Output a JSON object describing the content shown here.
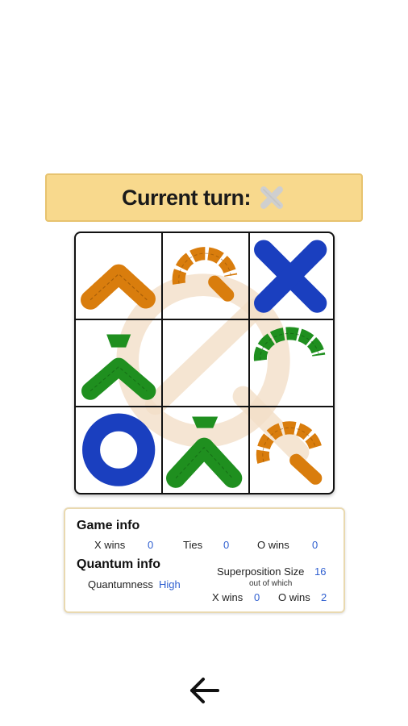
{
  "turn": {
    "label": "Current turn:",
    "current_player_icon": "x-mark-icon",
    "icon_color": "#cfcfcf"
  },
  "board": {
    "cells": [
      {
        "row": 0,
        "col": 0,
        "piece": "quantum-x-fragment",
        "color": "orange"
      },
      {
        "row": 0,
        "col": 1,
        "piece": "quantum-o-fragment",
        "color": "orange"
      },
      {
        "row": 0,
        "col": 2,
        "piece": "classical-x",
        "color": "blue"
      },
      {
        "row": 1,
        "col": 0,
        "piece": "quantum-x-fragment",
        "color": "green"
      },
      {
        "row": 1,
        "col": 1,
        "piece": "empty",
        "color": ""
      },
      {
        "row": 1,
        "col": 2,
        "piece": "quantum-o-fragment",
        "color": "green"
      },
      {
        "row": 2,
        "col": 0,
        "piece": "classical-o",
        "color": "blue"
      },
      {
        "row": 2,
        "col": 1,
        "piece": "quantum-x-fragment",
        "color": "green"
      },
      {
        "row": 2,
        "col": 2,
        "piece": "quantum-o-fragment",
        "color": "orange"
      }
    ],
    "colors": {
      "orange": "#d97d0d",
      "green": "#1f8f1f",
      "blue": "#1a3fbf",
      "watermark": "#f3dfc8"
    }
  },
  "game_info": {
    "title": "Game info",
    "x_wins_label": "X wins",
    "x_wins_value": "0",
    "ties_label": "Ties",
    "ties_value": "0",
    "o_wins_label": "O wins",
    "o_wins_value": "0"
  },
  "quantum_info": {
    "title": "Quantum info",
    "quantumness_label": "Quantumness",
    "quantumness_value": "High",
    "superposition_label": "Superposition Size",
    "superposition_value": "16",
    "out_of_which": "out of which",
    "x_wins_label": "X wins",
    "x_wins_value": "0",
    "o_wins_label": "O wins",
    "o_wins_value": "2"
  },
  "navigation": {
    "back_icon": "arrow-left-icon"
  }
}
